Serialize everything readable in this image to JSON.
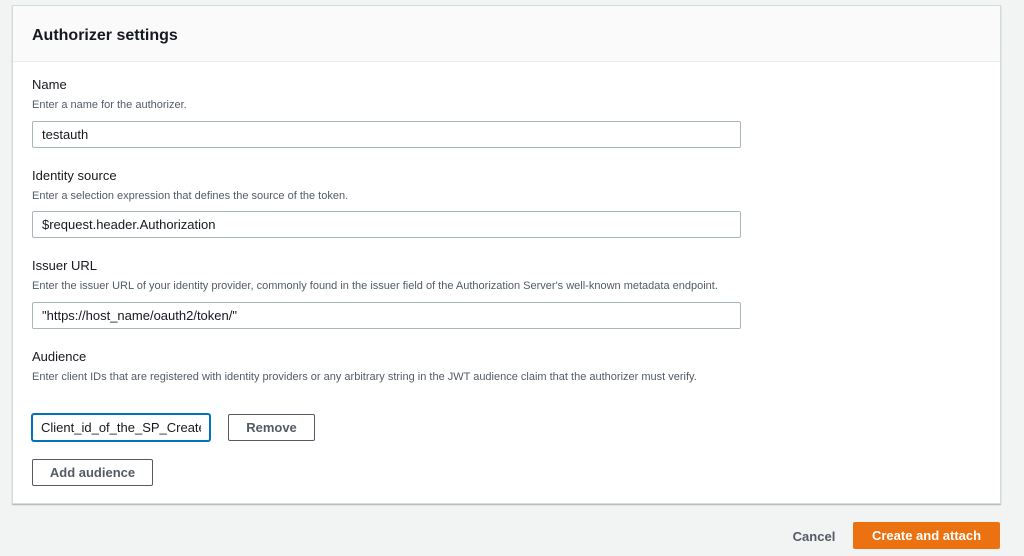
{
  "panel": {
    "title": "Authorizer settings"
  },
  "fields": {
    "name": {
      "label": "Name",
      "description": "Enter a name for the authorizer.",
      "value": "testauth"
    },
    "identity_source": {
      "label": "Identity source",
      "description": "Enter a selection expression that defines the source of the token.",
      "value": "$request.header.Authorization"
    },
    "issuer_url": {
      "label": "Issuer URL",
      "description": "Enter the issuer URL of your identity provider, commonly found in the issuer field of the Authorization Server's well-known metadata endpoint.",
      "value": "\"https://host_name/oauth2/token/\""
    },
    "audience": {
      "label": "Audience",
      "description": "Enter client IDs that are registered with identity providers or any arbitrary string in the JWT audience claim that the authorizer must verify.",
      "value": "Client_id_of_the_SP_Create",
      "remove_label": "Remove",
      "add_label": "Add audience"
    }
  },
  "footer": {
    "cancel_label": "Cancel",
    "primary_label": "Create and attach"
  },
  "colors": {
    "primary": "#ec7211",
    "focus": "#0073bb"
  }
}
